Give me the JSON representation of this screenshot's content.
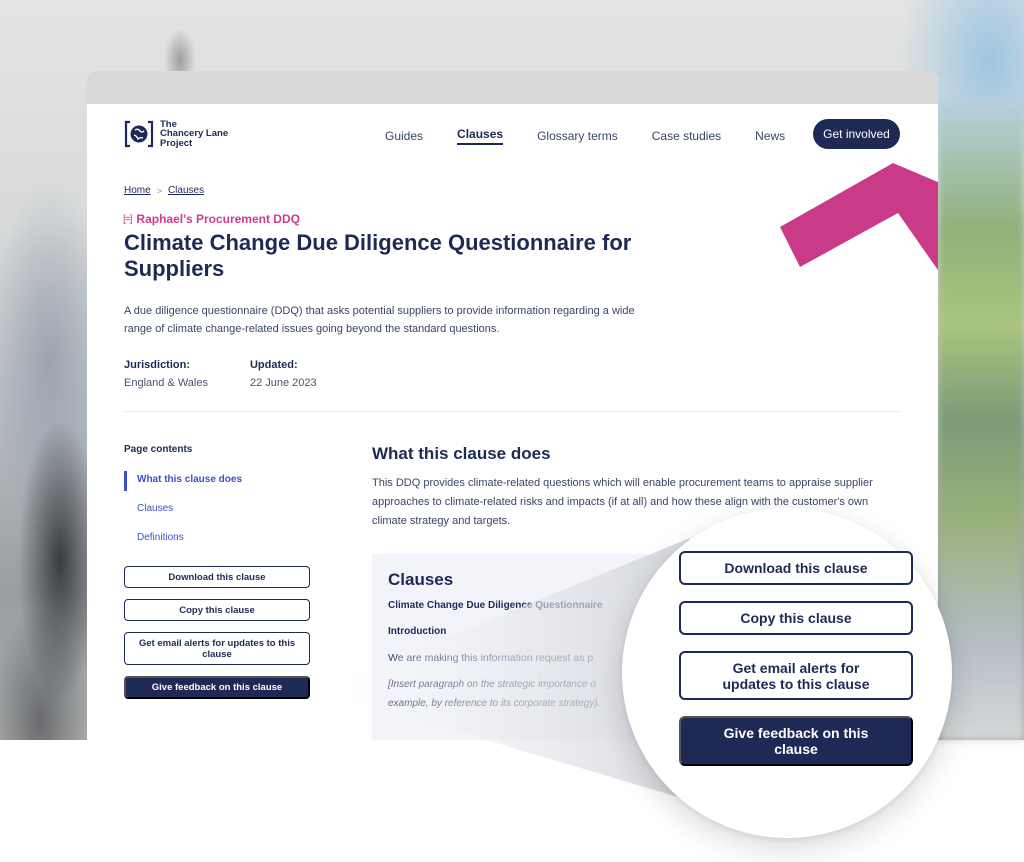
{
  "header": {
    "logo_lines": [
      "The",
      "Chancery Lane",
      "Project"
    ],
    "nav": [
      {
        "label": "Guides",
        "active": false
      },
      {
        "label": "Clauses",
        "active": true
      },
      {
        "label": "Glossary terms",
        "active": false
      },
      {
        "label": "Case studies",
        "active": false
      },
      {
        "label": "News",
        "active": false
      }
    ],
    "cta_label": "Get involved"
  },
  "breadcrumb": {
    "items": [
      "Home",
      "Clauses"
    ],
    "separator": ">"
  },
  "hero": {
    "tag_icon": "[=]",
    "tag": "Raphael's Procurement DDQ",
    "title": "Climate Change Due Diligence Questionnaire for Suppliers",
    "description": "A due diligence questionnaire (DDQ) that asks potential suppliers to provide information regarding a wide range of climate change-related issues going beyond the standard questions.",
    "meta": [
      {
        "label": "Jurisdiction:",
        "value": "England & Wales"
      },
      {
        "label": "Updated:",
        "value": "22 June 2023"
      }
    ]
  },
  "sidebar": {
    "toc_title": "Page contents",
    "toc": [
      {
        "label": "What this clause does",
        "active": true
      },
      {
        "label": "Clauses",
        "active": false
      },
      {
        "label": "Definitions",
        "active": false
      }
    ],
    "actions": {
      "download": "Download this clause",
      "copy": "Copy this clause",
      "alerts": "Get email alerts for updates to this clause",
      "feedback": "Give feedback on this clause"
    }
  },
  "main": {
    "section_title": "What this clause does",
    "section_text": "This DDQ provides climate-related questions which will enable procurement teams to appraise supplier approaches to climate-related risks and impacts (if at all) and how these align with the customer's own climate strategy and targets.",
    "clauses": {
      "title": "Clauses",
      "subtitle": "Climate Change Due Diligence Questionnaire",
      "intro_heading": "Introduction",
      "intro_text": "We are making this information request as p",
      "insert_line_1": "[Insert paragraph on the strategic importance o",
      "insert_line_2": "example, by reference to its corporate strategy)."
    }
  },
  "magnifier": {
    "download": "Download this clause",
    "copy": "Copy this clause",
    "alerts": "Get email alerts for updates to this clause",
    "feedback": "Give feedback on this clause"
  },
  "colors": {
    "navy": "#1e2a55",
    "pink": "#d13b8c",
    "link_blue": "#3d4fcf",
    "clause_bg": "#f3f4fa"
  }
}
